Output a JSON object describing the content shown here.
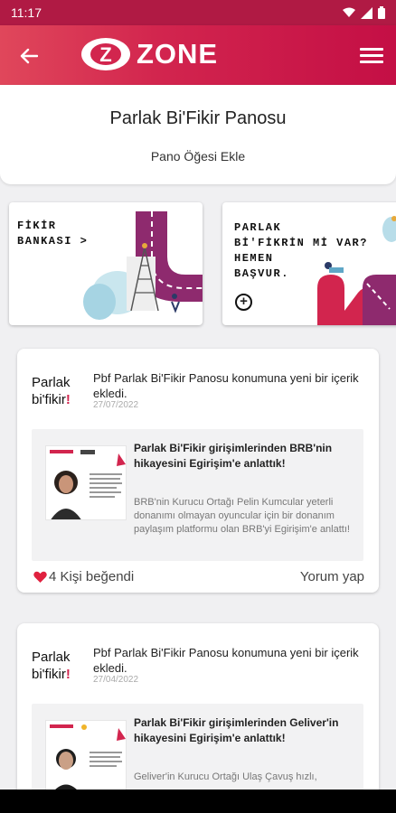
{
  "status_bar": {
    "time": "11:17"
  },
  "app_bar": {
    "logo_letter": "Z",
    "logo_text": "ZONE"
  },
  "header": {
    "title": "Parlak Bi'Fikir Panosu",
    "add_item_label": "Pano Öğesi Ekle"
  },
  "banners": [
    {
      "lines": [
        "FİKİR",
        "BANKASI >"
      ]
    },
    {
      "lines": [
        "PARLAK",
        "Bİ'FİKRİN Mİ VAR?",
        "HEMEN",
        "BAŞVUR."
      ]
    }
  ],
  "posts": [
    {
      "logo_line1": "Parlak",
      "logo_line2": "bi'fikir",
      "logo_bang": "!",
      "title": "Pbf Parlak Bi'Fikir Panosu konumuna yeni bir içerik ekledi.",
      "date": "27/07/2022",
      "inner_title": "Parlak Bi'Fikir girişimlerinden BRB'nin hikayesini Egirişim'e anlattık!",
      "inner_desc": "BRB'nin Kurucu Ortağı Pelin Kumcular yeterli donanımı olmayan oyuncular için bir donanım paylaşım platformu olan BRB'yi Egirişim'e anlattı!",
      "likes": "4 Kişi beğendi",
      "comment": "Yorum yap"
    },
    {
      "logo_line1": "Parlak",
      "logo_line2": "bi'fikir",
      "logo_bang": "!",
      "title": "Pbf Parlak Bi'Fikir Panosu konumuna yeni bir içerik ekledi.",
      "date": "27/04/2022",
      "inner_title": "Parlak Bi'Fikir girişimlerinden Geliver'in hikayesini Egirişim'e anlattık!",
      "inner_desc": "Geliver'in Kurucu Ortağı Ulaş Çavuş hızlı,"
    }
  ],
  "colors": {
    "brand": "#d2254e",
    "status_bar": "#b01a44"
  },
  "icons": [
    "back-arrow-icon",
    "hamburger-menu-icon",
    "wifi-icon",
    "signal-icon",
    "battery-icon",
    "heart-icon",
    "plus-circle-icon"
  ]
}
